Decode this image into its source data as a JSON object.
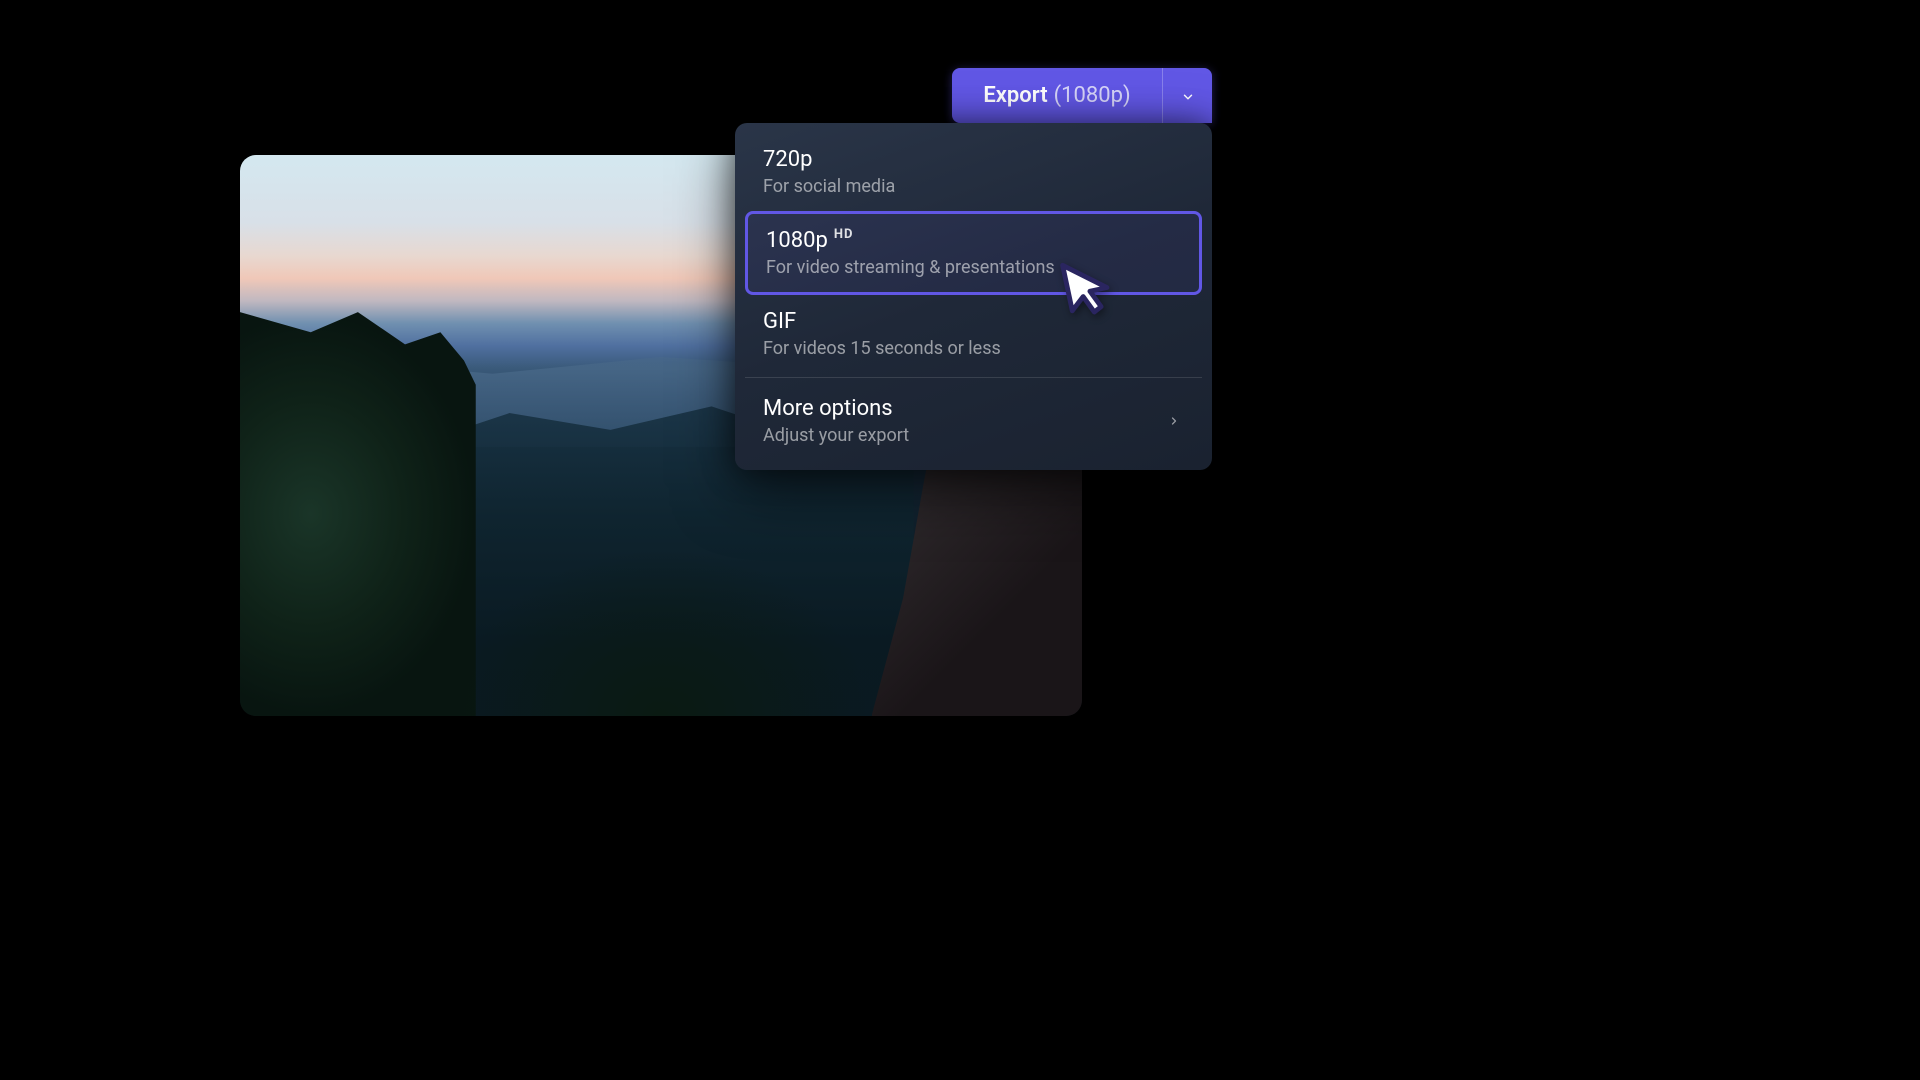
{
  "export": {
    "label": "Export",
    "resolution": "(1080p)"
  },
  "dropdown": {
    "items": [
      {
        "title": "720p",
        "desc": "For social media",
        "badge": ""
      },
      {
        "title": "1080p",
        "desc": "For video streaming & presentations",
        "badge": "HD"
      },
      {
        "title": "GIF",
        "desc": "For videos 15 seconds or less",
        "badge": ""
      }
    ],
    "more": {
      "title": "More options",
      "desc": "Adjust your export"
    }
  },
  "colors": {
    "accent": "#6157e5",
    "panel": "#1f2838"
  }
}
